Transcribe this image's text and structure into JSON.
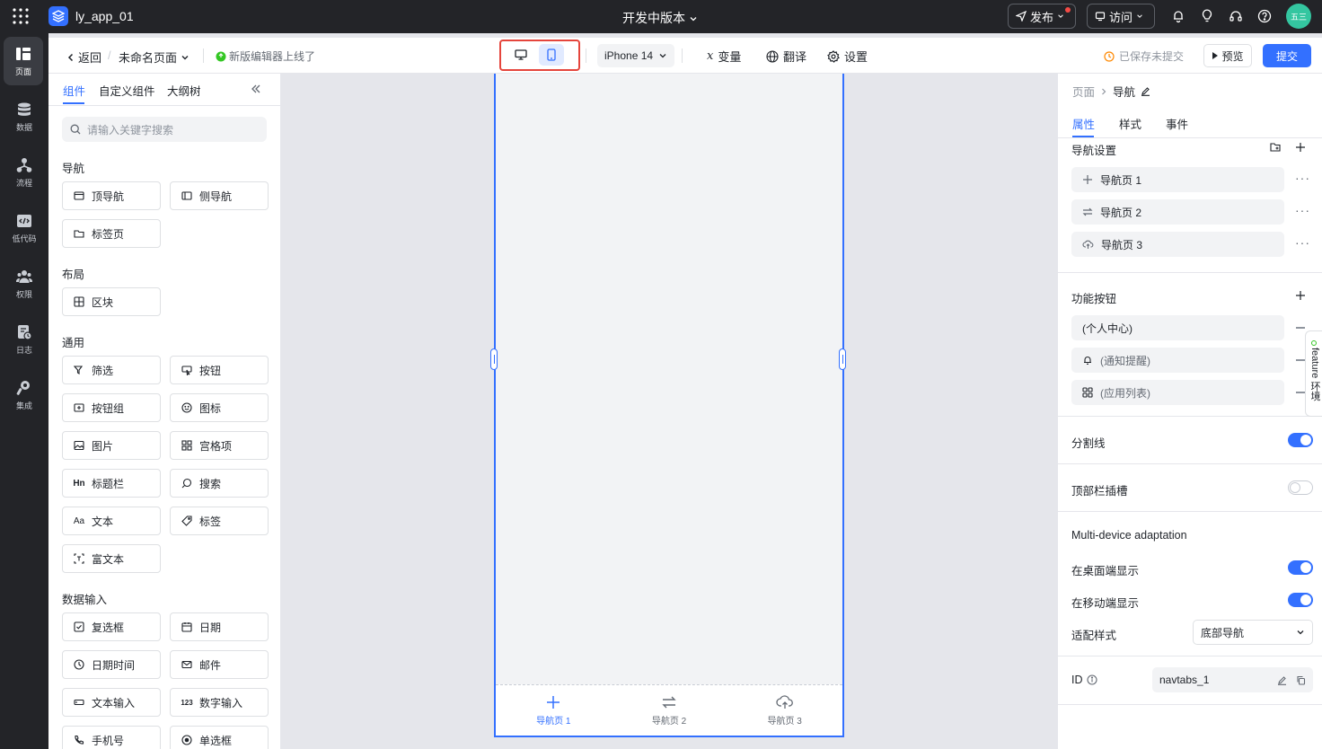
{
  "app": {
    "name": "ly_app_01",
    "version_label": "开发中版本",
    "avatar_text": "五三"
  },
  "topbar": {
    "publish_label": "发布",
    "visit_label": "访问"
  },
  "left_nav": [
    {
      "label": "页面",
      "icon": "page-icon"
    },
    {
      "label": "数据",
      "icon": "database-icon"
    },
    {
      "label": "流程",
      "icon": "flow-icon"
    },
    {
      "label": "低代码",
      "icon": "code-icon"
    },
    {
      "label": "权限",
      "icon": "users-icon"
    },
    {
      "label": "日志",
      "icon": "log-icon"
    },
    {
      "label": "集成",
      "icon": "wrench-icon"
    }
  ],
  "toolbar": {
    "back_label": "返回",
    "page_name": "未命名页面",
    "notice": "新版编辑器上线了",
    "device": "iPhone 14",
    "variables_label": "变量",
    "translate_label": "翻译",
    "settings_label": "设置",
    "saved_status": "已保存未提交",
    "preview_label": "预览",
    "submit_label": "提交"
  },
  "left_panel": {
    "tabs": [
      "组件",
      "自定义组件",
      "大纲树"
    ],
    "search_placeholder": "请输入关键字搜索",
    "sections": [
      {
        "title": "导航",
        "items": [
          "顶导航",
          "侧导航",
          "标签页"
        ]
      },
      {
        "title": "布局",
        "items": [
          "区块"
        ]
      },
      {
        "title": "通用",
        "items": [
          "筛选",
          "按钮",
          "按钮组",
          "图标",
          "图片",
          "宫格项",
          "标题栏",
          "搜索",
          "文本",
          "标签",
          "富文本"
        ]
      },
      {
        "title": "数据输入",
        "items": [
          "复选框",
          "日期",
          "日期时间",
          "邮件",
          "文本输入",
          "数字输入",
          "手机号",
          "单选框"
        ]
      }
    ]
  },
  "canvas": {
    "bottom_nav": [
      "导航页 1",
      "导航页 2",
      "导航页 3"
    ]
  },
  "right_panel": {
    "breadcrumb": [
      "页面",
      "导航"
    ],
    "tabs": [
      "属性",
      "样式",
      "事件"
    ],
    "nav_settings_title": "导航设置",
    "nav_items": [
      "导航页 1",
      "导航页 2",
      "导航页 3"
    ],
    "func_buttons_title": "功能按钮",
    "func_buttons": [
      "(个人中心)",
      "(通知提醒)",
      "(应用列表)"
    ],
    "divider_label": "分割线",
    "divider_on": true,
    "top_slot_label": "顶部栏插槽",
    "top_slot_on": false,
    "multi_device_title": "Multi-device adaptation",
    "show_desktop_label": "在桌面端显示",
    "show_desktop_on": true,
    "show_mobile_label": "在移动端显示",
    "show_mobile_on": true,
    "adapt_style_label": "适配样式",
    "adapt_style_value": "底部导航",
    "id_label": "ID",
    "id_value": "navtabs_1"
  },
  "feature_tab": {
    "label": "feature 环境"
  },
  "colors": {
    "accent": "#3370ff",
    "dark_bg": "#232428",
    "highlight_box": "#e5453c"
  }
}
